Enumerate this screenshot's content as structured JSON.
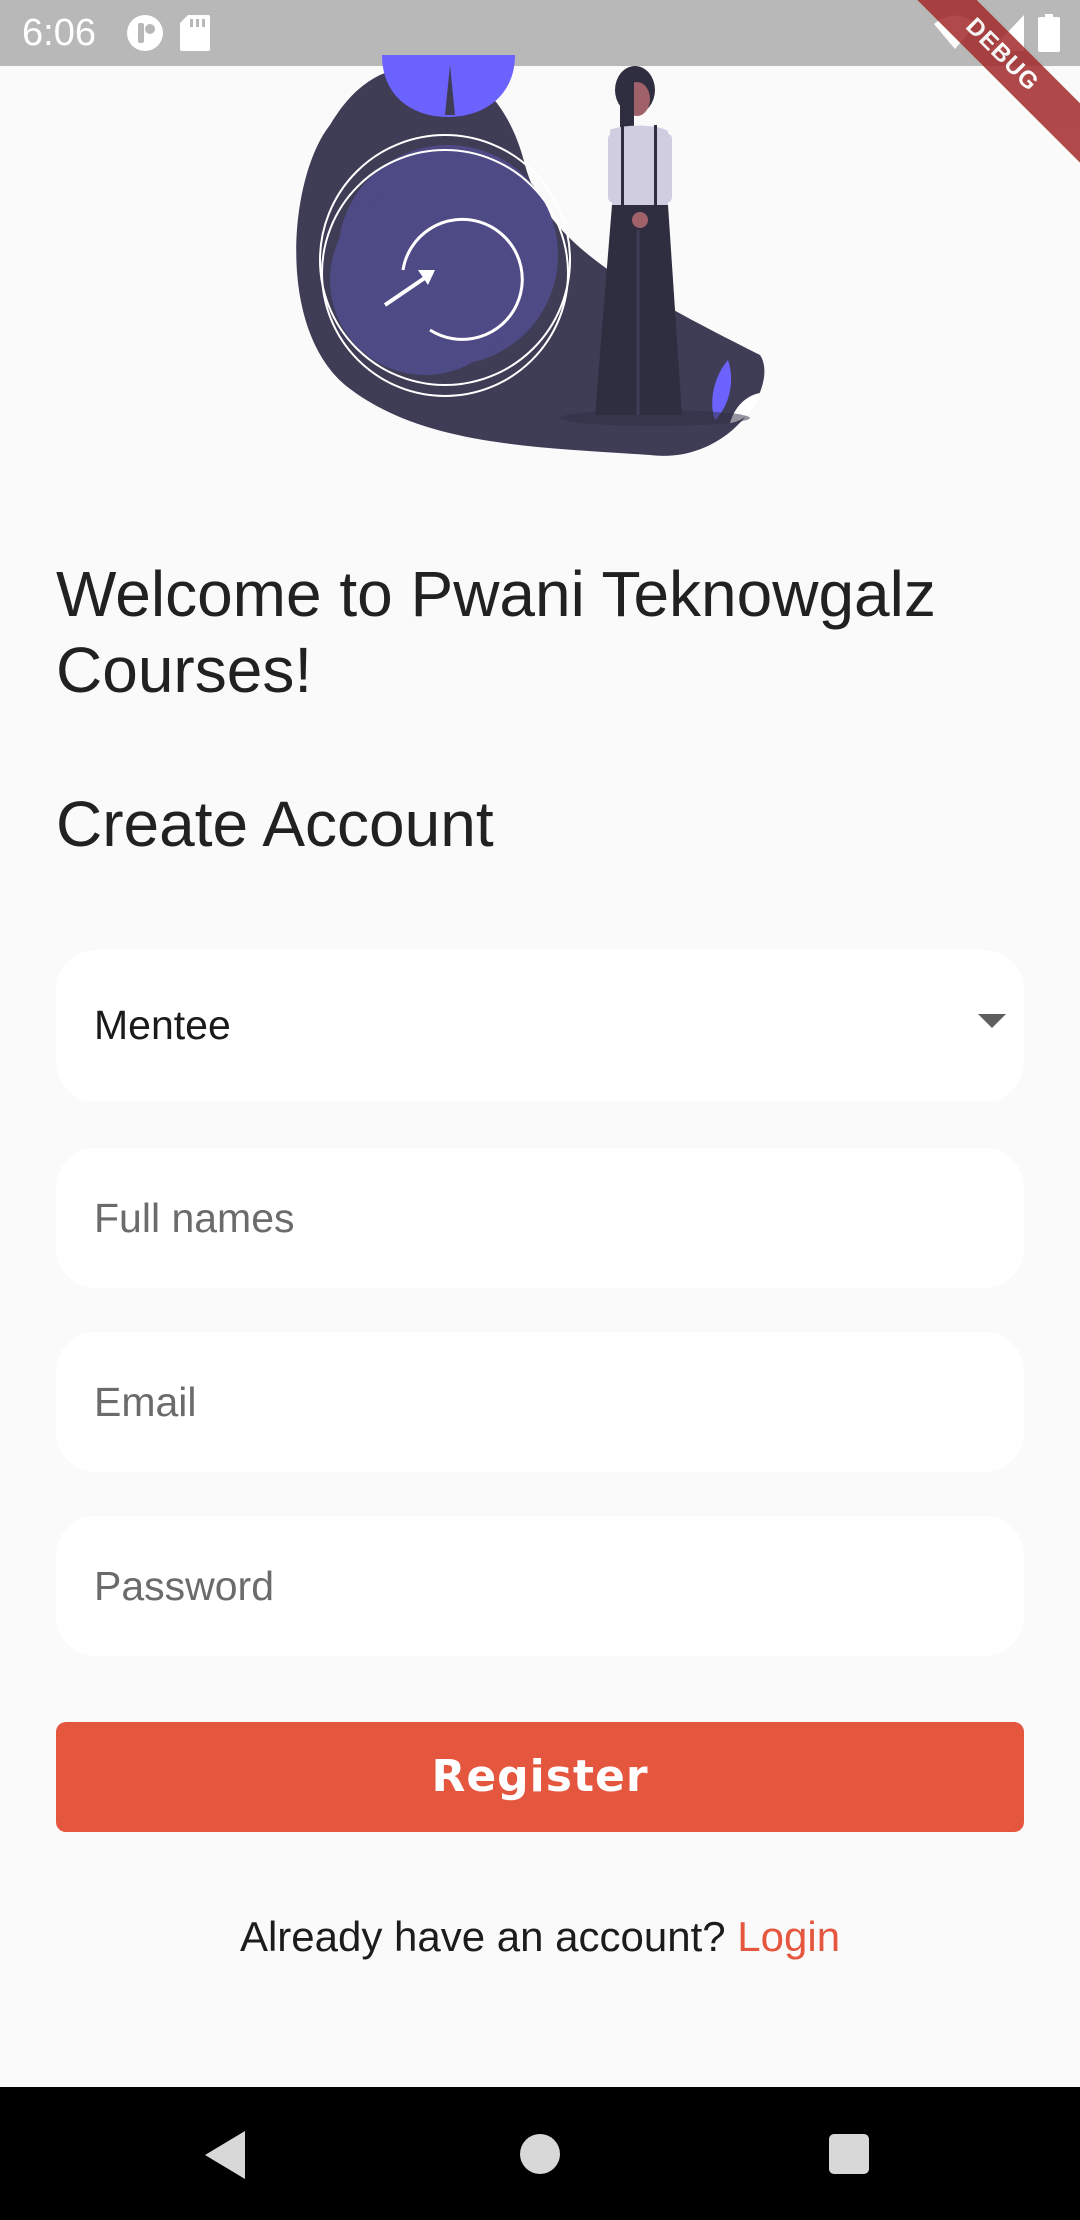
{
  "status_bar": {
    "time": "6:06",
    "icons": [
      "notification-app-icon",
      "sd-card-icon",
      "wifi-icon",
      "signal-icon",
      "battery-icon"
    ]
  },
  "debug_banner": {
    "label": "DEBUG"
  },
  "hero": {
    "illustration": "woman-standing-clock-illustration"
  },
  "welcome": {
    "title": "Welcome to Pwani Teknowgalz Courses!"
  },
  "form": {
    "heading": "Create Account",
    "role_dropdown": {
      "selected": "Mentee"
    },
    "full_names": {
      "placeholder": "Full names",
      "value": ""
    },
    "email": {
      "placeholder": "Email",
      "value": ""
    },
    "password": {
      "placeholder": "Password",
      "value": ""
    },
    "register_label": "Register"
  },
  "login_prompt": {
    "text": "Already have an account?",
    "link_label": "Login"
  },
  "colors": {
    "accent": "#e5563f",
    "illustration_purple": "#6c63ff",
    "illustration_dark": "#3f3d56"
  },
  "nav_bar": {
    "buttons": [
      "back-icon",
      "home-icon",
      "recents-icon"
    ]
  }
}
